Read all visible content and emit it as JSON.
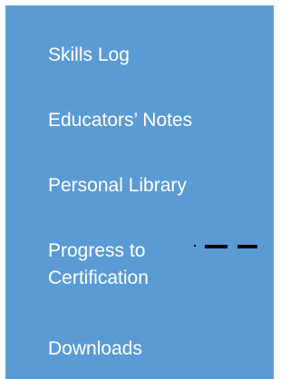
{
  "menu": {
    "items": [
      {
        "id": "skills-log",
        "label": "Skills Log"
      },
      {
        "id": "educators-notes",
        "label": "Educators’ Notes"
      },
      {
        "id": "personal-library",
        "label": "Personal Library"
      },
      {
        "id": "progress-to-certification",
        "label": "Progress to Certification"
      },
      {
        "id": "downloads",
        "label": "Downloads"
      }
    ]
  },
  "colors": {
    "panel_background": "#5b9bd5",
    "text": "#ffffff",
    "dashed_line": "#000000"
  }
}
